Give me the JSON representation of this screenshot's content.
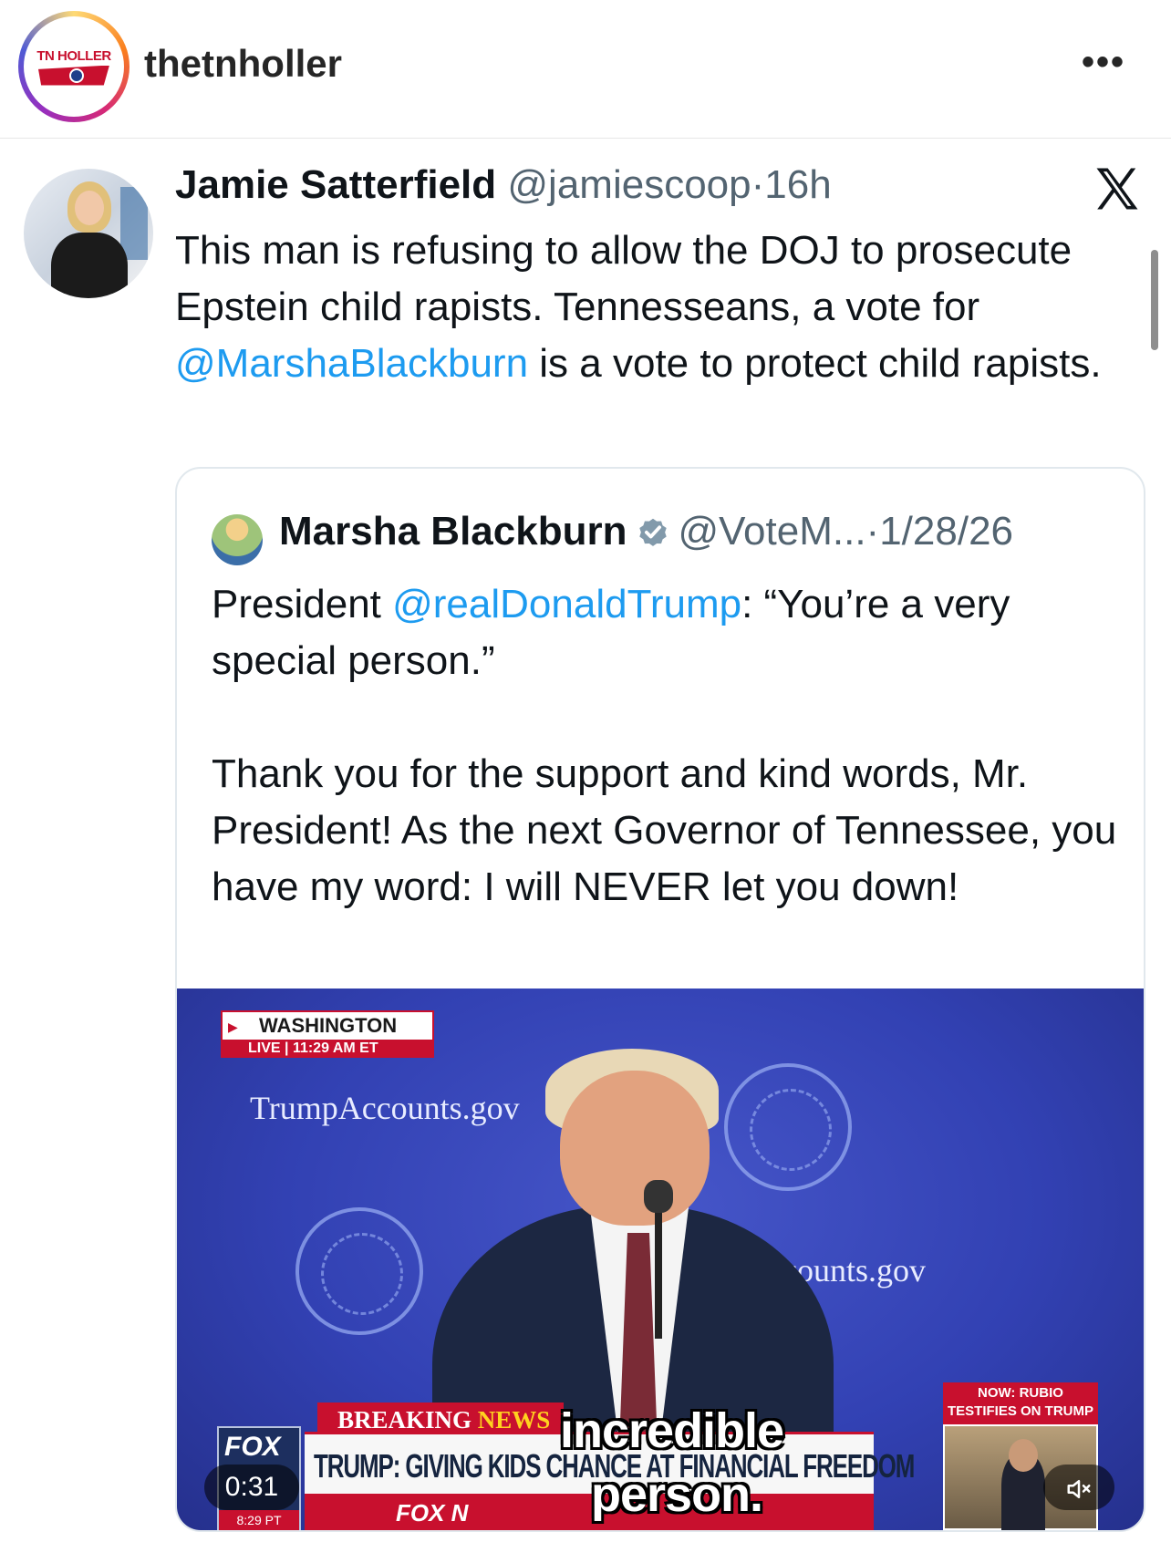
{
  "instagram": {
    "username": "thetnholler",
    "avatar_logo_text": "TN HOLLER",
    "more_icon": "more-horizontal-icon"
  },
  "tweet": {
    "author_name": "Jamie Satterfield",
    "author_handle": "@jamiescoop",
    "separator": "·",
    "time": "16h",
    "platform_icon": "x-logo-icon",
    "text_part1": "This man is refusing to allow the DOJ to prosecute Epstein child rapists. Tennesseans, a vote for ",
    "mention": "@MarshaBlackburn",
    "text_part2": " is a vote to protect child rapists."
  },
  "quoted_tweet": {
    "author_name": "Marsha Blackburn",
    "verified_icon": "verified-badge-icon",
    "author_handle": "@VoteM...",
    "separator": "·",
    "date": "1/28/26",
    "line1_prefix": "President ",
    "line1_mention": "@realDonaldTrump",
    "line1_suffix": ": “You’re a very special person.”",
    "paragraph2": "Thank you for the support and kind words, Mr. President! As the next Governor of Tennessee, you have my word: I will NEVER let you down!"
  },
  "video": {
    "location": "WASHINGTON",
    "live_label": "LIVE",
    "live_time": "11:29 AM ET",
    "backdrop_text_1": "TrumpAccounts.gov",
    "backdrop_text_2": "Accounts.gov",
    "breaking_label": "BREAKING",
    "breaking_news": "NEWS",
    "chyron": "TRUMP: GIVING KIDS CHANCE AT FINANCIAL FREEDOM",
    "caption_line1": "incredible",
    "caption_line2": "person.",
    "fox_logo": "FOX",
    "fox_ticker": "FOX N",
    "fox_time": "8:29 PT",
    "pip_banner": "NOW: RUBIO TESTIFIES ON TRUMP FOREIGN POLICY",
    "timer": "0:31",
    "mute_icon": "speaker-muted-icon"
  },
  "colors": {
    "link": "#1d9bf0",
    "secondary_text": "#536471",
    "fox_red": "#c8102e",
    "video_blue": "#3241b3"
  }
}
